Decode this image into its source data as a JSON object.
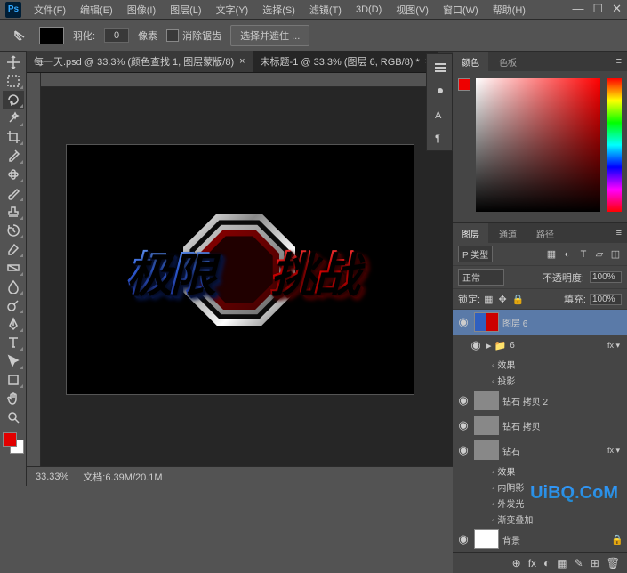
{
  "app": {
    "logo": "Ps"
  },
  "menu": [
    "文件(F)",
    "编辑(E)",
    "图像(I)",
    "图层(L)",
    "文字(Y)",
    "选择(S)",
    "滤镜(T)",
    "3D(D)",
    "视图(V)",
    "窗口(W)",
    "帮助(H)"
  ],
  "win_controls": {
    "min": "—",
    "max": "☐",
    "close": "✕"
  },
  "options": {
    "feather_label": "羽化:",
    "feather_value": "0",
    "feather_unit": "像素",
    "antialias": "消除锯齿",
    "refine": "选择并遮住 ..."
  },
  "tabs": [
    {
      "label": "每一天.psd @ 33.3% (颜色查找 1, 图层蒙版/8)",
      "active": false
    },
    {
      "label": "未标题-1 @ 33.3% (图层 6, RGB/8) *",
      "active": true
    }
  ],
  "canvas_text": {
    "blue1": "极",
    "blue2": "限",
    "red1": "挑",
    "red2": "战"
  },
  "status": {
    "zoom": "33.33%",
    "docinfo": "文档:6.39M/20.1M"
  },
  "color_panel": {
    "tabs": [
      "颜色",
      "色板"
    ]
  },
  "layers_panel": {
    "tabs": [
      "图层",
      "通道",
      "路径"
    ],
    "kind": "P 类型",
    "blend": "正常",
    "opacity_label": "不透明度:",
    "opacity": "100%",
    "lock_label": "锁定:",
    "fill_label": "填充:",
    "fill": "100%",
    "layers": [
      {
        "eye": "◉",
        "name": "图层 6",
        "selected": true,
        "thumb": "art"
      },
      {
        "eye": "◉",
        "name": "6",
        "group": true,
        "fx": "fx ▾"
      },
      {
        "sub": true,
        "name": "效果"
      },
      {
        "sub": true,
        "name": "投影"
      },
      {
        "eye": "◉",
        "name": "钻石 拷贝 2",
        "thumb": "stone"
      },
      {
        "eye": "◉",
        "name": "钻石 拷贝",
        "thumb": "stone"
      },
      {
        "eye": "◉",
        "name": "钻石",
        "thumb": "stone",
        "fx": "fx ▾"
      },
      {
        "sub": true,
        "name": "效果"
      },
      {
        "sub": true,
        "name": "内阴影"
      },
      {
        "sub": true,
        "name": "外发光"
      },
      {
        "sub": true,
        "name": "渐变叠加"
      },
      {
        "eye": "◉",
        "name": "背景",
        "thumb": "white",
        "locked": true
      }
    ],
    "footer_icons": [
      "⊕",
      "fx",
      "◐",
      "▦",
      "✎",
      "⊞",
      "🗑"
    ]
  },
  "watermark": "UiBQ.CoM"
}
